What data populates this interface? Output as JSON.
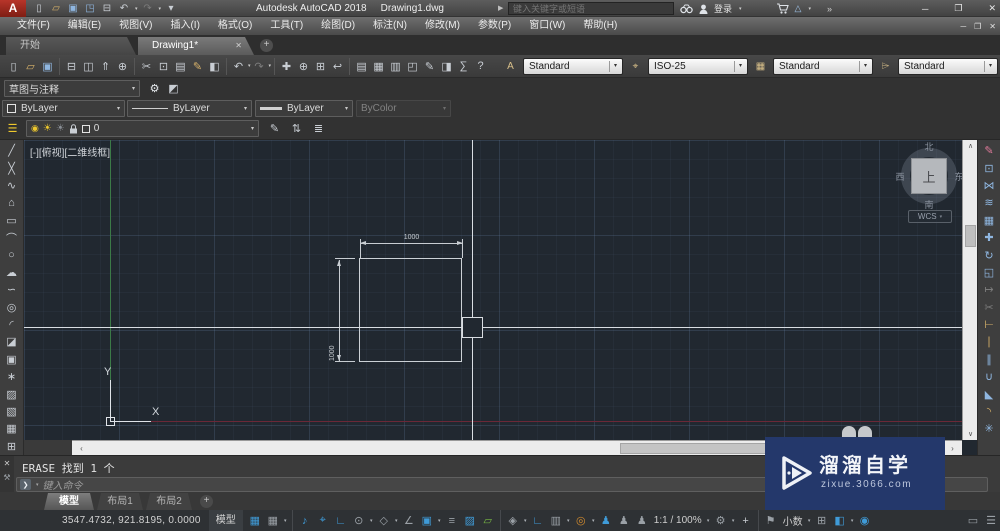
{
  "titlebar": {
    "title_app": "Autodesk AutoCAD 2018",
    "title_doc": "Drawing1.dwg",
    "search_placeholder": "键入关键字或短语",
    "sign_in": "登录"
  },
  "menubar": {
    "items": [
      "文件(F)",
      "编辑(E)",
      "视图(V)",
      "插入(I)",
      "格式(O)",
      "工具(T)",
      "绘图(D)",
      "标注(N)",
      "修改(M)",
      "参数(P)",
      "窗口(W)",
      "帮助(H)"
    ]
  },
  "file_tabs": {
    "start": "开始",
    "drawing": "Drawing1*"
  },
  "glyphs": {
    "min": "─",
    "max": "❐",
    "close": "✕",
    "caret": "▾",
    "plus": "+",
    "tab_close": "✕",
    "arrow_left": "‹",
    "arrow_right": "›",
    "arrow_up": "∧",
    "arrow_down": "∨",
    "prompt": "❯",
    "wrench": "⚒",
    "search_play": "▶",
    "chev2": "»",
    "a360": "△",
    "logo_letter": "A"
  },
  "style_toolbar": {
    "text_style": "Standard",
    "dim_style": "ISO-25",
    "table_style": "Standard",
    "mleader_style": "Standard",
    "icons": {
      "text": "A",
      "dim": "⌖",
      "table": "▦",
      "mleader": "⌲"
    }
  },
  "workspace": {
    "value": "草图与注释"
  },
  "properties": {
    "color": "ByLayer",
    "linetype": "ByLayer",
    "lineweight": "ByLayer",
    "plotstyle": "ByColor"
  },
  "layers": {
    "current": "0"
  },
  "viewport": {
    "label": "[-][俯视][二维线框]",
    "viewcube": {
      "n": "北",
      "s": "南",
      "e": "东",
      "w": "西",
      "top": "上",
      "wcs": "WCS"
    },
    "ucs": {
      "x": "X",
      "y": "Y"
    }
  },
  "drawing": {
    "dim_h": "1000",
    "dim_v": "1000"
  },
  "command": {
    "history": "ERASE 找到 1 个",
    "placeholder": "键入命令"
  },
  "layout_tabs": {
    "model": "模型",
    "layout1": "布局1",
    "layout2": "布局2"
  },
  "statusbar": {
    "coords": "3547.4732, 921.8195, 0.0000",
    "model": "模型",
    "annotation_scale": "1:1 / 100%",
    "units": "小数"
  },
  "watermark": {
    "title": "溜溜自学",
    "url": "zixue.3066.com"
  },
  "colors": {
    "blue": "#3f9bd8",
    "gray": "#9aa0a6",
    "green": "#79b944",
    "orange": "#d08a2e",
    "light": "#c9ced4",
    "tan": "#d9b36a",
    "steel": "#8fb6e0",
    "dim": "#7c7c7c",
    "rose": "#e07a9a",
    "yellow": "#eec82d"
  },
  "qat_items": [
    {
      "n": "qnew",
      "g": "▯"
    },
    {
      "n": "open",
      "g": "▱",
      "c": "tan"
    },
    {
      "n": "save",
      "g": "▣",
      "c": "steel"
    },
    {
      "n": "save-as",
      "g": "◳",
      "c": "steel"
    },
    {
      "n": "plot",
      "g": "⊟"
    },
    {
      "n": "undo",
      "g": "↶",
      "caret": true
    },
    {
      "n": "redo",
      "g": "↷",
      "c": "dim",
      "caret": true
    },
    {
      "n": "customize-qat",
      "g": "▾"
    }
  ],
  "toolbar_items": [
    {
      "n": "qnew",
      "g": "▯"
    },
    {
      "n": "open",
      "g": "▱",
      "c": "tan"
    },
    {
      "n": "save",
      "g": "▣",
      "c": "steel"
    },
    {
      "sep": true
    },
    {
      "n": "plot",
      "g": "⊟"
    },
    {
      "n": "plot-preview",
      "g": "◫"
    },
    {
      "n": "publish",
      "g": "⇑"
    },
    {
      "n": "transmit",
      "g": "⊕"
    },
    {
      "sep": true
    },
    {
      "n": "cut",
      "g": "✂"
    },
    {
      "n": "copy-clip",
      "g": "⊡"
    },
    {
      "n": "paste",
      "g": "▤"
    },
    {
      "n": "match-properties",
      "g": "✎",
      "c": "tan"
    },
    {
      "n": "block-editor",
      "g": "◧"
    },
    {
      "sep": true
    },
    {
      "n": "undo",
      "g": "↶",
      "caret": true
    },
    {
      "n": "redo",
      "g": "↷",
      "c": "dim",
      "caret": true
    },
    {
      "sep": true
    },
    {
      "n": "pan",
      "g": "✚"
    },
    {
      "n": "zoom-realtime",
      "g": "⊕"
    },
    {
      "n": "zoom-window",
      "g": "⊞"
    },
    {
      "n": "zoom-previous",
      "g": "↩"
    },
    {
      "sep": true
    },
    {
      "n": "properties",
      "g": "▤"
    },
    {
      "n": "designcenter",
      "g": "▦"
    },
    {
      "n": "tool-palettes",
      "g": "▥"
    },
    {
      "n": "sheet-set-manager",
      "g": "◰"
    },
    {
      "n": "markup-set-manager",
      "g": "✎"
    },
    {
      "n": "render",
      "g": "◨"
    },
    {
      "n": "quick-calc",
      "g": "∑"
    },
    {
      "n": "help",
      "g": "?"
    }
  ],
  "draw_items": [
    {
      "n": "line",
      "g": "╱"
    },
    {
      "n": "construction-line",
      "g": "╳"
    },
    {
      "n": "polyline",
      "g": "∿"
    },
    {
      "n": "polygon",
      "g": "⌂"
    },
    {
      "n": "rectangle",
      "g": "▭"
    },
    {
      "n": "arc",
      "g": "⌒"
    },
    {
      "n": "circle",
      "g": "○"
    },
    {
      "n": "revision-cloud",
      "g": "☁"
    },
    {
      "n": "spline",
      "g": "∽"
    },
    {
      "n": "ellipse",
      "g": "◎"
    },
    {
      "n": "ellipse-arc",
      "g": "◜"
    },
    {
      "n": "insert-block",
      "g": "◪"
    },
    {
      "n": "make-block",
      "g": "▣"
    },
    {
      "n": "point",
      "g": "∗"
    },
    {
      "n": "hatch",
      "g": "▨"
    },
    {
      "n": "gradient",
      "g": "▧"
    },
    {
      "n": "region",
      "g": "▦"
    },
    {
      "n": "table",
      "g": "⊞"
    }
  ],
  "modify_items": [
    {
      "n": "erase",
      "g": "✎",
      "c": "rose"
    },
    {
      "n": "copy",
      "g": "⊡",
      "c": "steel"
    },
    {
      "n": "mirror",
      "g": "⋈",
      "c": "steel"
    },
    {
      "n": "offset",
      "g": "≋",
      "c": "steel"
    },
    {
      "n": "array",
      "g": "▦",
      "c": "steel"
    },
    {
      "n": "move",
      "g": "✚",
      "c": "steel"
    },
    {
      "n": "rotate",
      "g": "↻",
      "c": "steel"
    },
    {
      "n": "scale",
      "g": "◱",
      "c": "steel"
    },
    {
      "n": "stretch",
      "g": "↦",
      "c": "dim"
    },
    {
      "n": "trim",
      "g": "✂",
      "c": "dim"
    },
    {
      "n": "extend",
      "g": "⊢",
      "c": "tan"
    },
    {
      "n": "break-at-point",
      "g": "∣",
      "c": "tan"
    },
    {
      "n": "break",
      "g": "∥",
      "c": "steel"
    },
    {
      "n": "join",
      "g": "∪",
      "c": "steel"
    },
    {
      "n": "chamfer",
      "g": "◣",
      "c": "steel"
    },
    {
      "n": "fillet",
      "g": "◝",
      "c": "tan"
    },
    {
      "n": "explode",
      "g": "✳",
      "c": "steel"
    }
  ],
  "layer_row_icons": [
    {
      "n": "layer-properties-manager",
      "g": "☰",
      "c": "yellow"
    },
    {
      "n": "make-object-layer-current",
      "g": "✎",
      "c": "light"
    },
    {
      "n": "layer-previous",
      "g": "⇅",
      "c": "light"
    },
    {
      "n": "layer-states",
      "g": "≣",
      "c": "light"
    }
  ],
  "status_items": [
    {
      "t": "icon",
      "n": "grid",
      "g": "▦",
      "c": "blue"
    },
    {
      "t": "icon",
      "n": "snap-mode",
      "g": "▦",
      "c": "gray",
      "caret": true
    },
    {
      "t": "sep"
    },
    {
      "t": "icon",
      "n": "infer-constraints",
      "g": "♪",
      "c": "blue"
    },
    {
      "t": "icon",
      "n": "dynamic-input",
      "g": "⌖",
      "c": "blue"
    },
    {
      "t": "icon",
      "n": "ortho-mode",
      "g": "∟",
      "c": "blue"
    },
    {
      "t": "icon",
      "n": "polar-tracking",
      "g": "⊙",
      "c": "gray",
      "caret": true
    },
    {
      "t": "icon",
      "n": "isometric-drafting",
      "g": "◇",
      "c": "gray",
      "caret": true
    },
    {
      "t": "icon",
      "n": "osnap-tracking",
      "g": "∠",
      "c": "gray"
    },
    {
      "t": "icon",
      "n": "object-snap",
      "g": "▣",
      "c": "blue",
      "caret": true
    },
    {
      "t": "icon",
      "n": "lineweight",
      "g": "≡",
      "c": "gray"
    },
    {
      "t": "icon",
      "n": "transparency",
      "g": "▨",
      "c": "blue"
    },
    {
      "t": "icon",
      "n": "selection-cycling",
      "g": "▱",
      "c": "green"
    },
    {
      "t": "sep"
    },
    {
      "t": "icon",
      "n": "3d-object-snap",
      "g": "◈",
      "c": "gray",
      "caret": true
    },
    {
      "t": "icon",
      "n": "dynamic-ucs",
      "g": "∟",
      "c": "blue"
    },
    {
      "t": "icon",
      "n": "selection-filtering",
      "g": "▥",
      "c": "gray",
      "caret": true
    },
    {
      "t": "icon",
      "n": "gizmo",
      "g": "◎",
      "c": "orange",
      "caret": true
    },
    {
      "t": "icon",
      "n": "annotation-visibility",
      "g": "♟",
      "c": "blue"
    },
    {
      "t": "icon",
      "n": "annotation-autoscale",
      "g": "♟",
      "c": "gray"
    },
    {
      "t": "icon",
      "n": "annotation-scale",
      "g": "♟",
      "c": "gray"
    },
    {
      "t": "text",
      "n": "annotation-scale-value",
      "bind": "statusbar.annotation_scale",
      "caret": true
    },
    {
      "t": "icon",
      "n": "workspace-switching",
      "g": "⚙",
      "c": "gray",
      "caret": true
    },
    {
      "t": "icon",
      "n": "annotation-add-scales",
      "g": "+",
      "c": "light"
    },
    {
      "t": "sep"
    },
    {
      "t": "icon",
      "n": "annotation-monitor",
      "g": "⚑",
      "c": "gray"
    },
    {
      "t": "text",
      "n": "units-value",
      "bind": "statusbar.units",
      "caret": true
    },
    {
      "t": "icon",
      "n": "quick-properties",
      "g": "⊞",
      "c": "gray"
    },
    {
      "t": "icon",
      "n": "graphics-performance",
      "g": "◧",
      "c": "blue",
      "caret": true
    },
    {
      "t": "icon",
      "n": "isolate-objects",
      "g": "◉",
      "c": "blue"
    },
    {
      "t": "spacer"
    },
    {
      "t": "icon",
      "n": "clean-screen",
      "g": "▭",
      "c": "gray"
    },
    {
      "t": "icon",
      "n": "customization",
      "g": "☰",
      "c": "gray"
    }
  ]
}
